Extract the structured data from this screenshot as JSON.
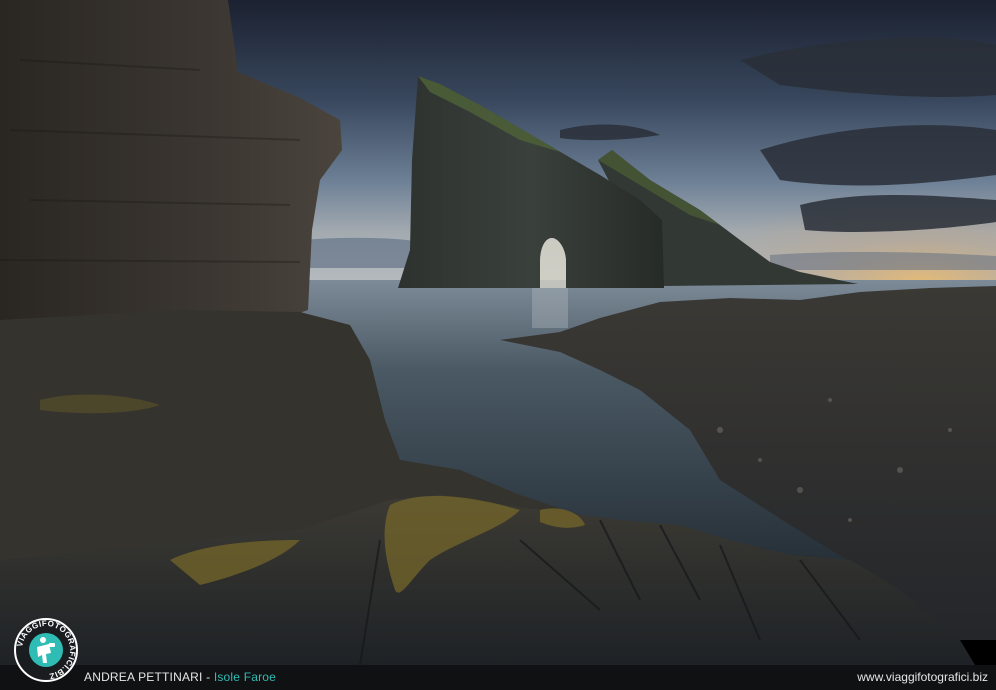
{
  "footer": {
    "author": "ANDREA PETTINARI",
    "separator": " - ",
    "location": "Isole Faroe",
    "website": "www.viaggifotografici.biz"
  },
  "logo": {
    "text": "VIAGGIFOTOGRAFICI.BIZ",
    "icon": "photographer-icon"
  },
  "colors": {
    "accent": "#2fbcb5",
    "footer_bg": "#101112",
    "sky_top": "#1e2636",
    "horizon_glow": "#e0b574",
    "water": "#3b4a55"
  }
}
